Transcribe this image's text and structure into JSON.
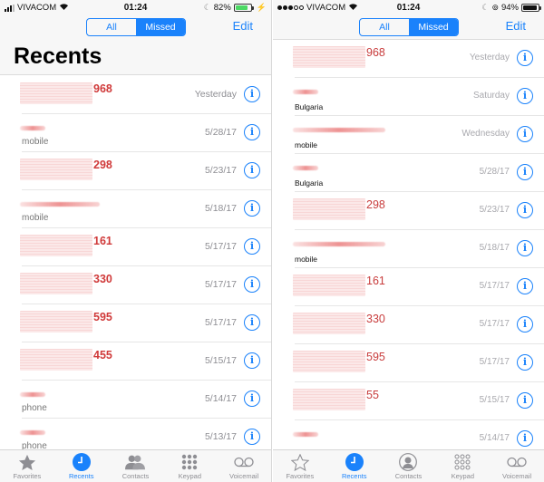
{
  "screens": [
    {
      "status": {
        "carrier": "VIVACOM",
        "time": "01:24",
        "battery": "82%",
        "signal_style": "bars",
        "charging": true
      },
      "nav": {
        "segments": [
          "All",
          "Missed"
        ],
        "active_segment": "Missed",
        "edit": "Edit"
      },
      "title": "Recents",
      "rows": [
        {
          "redacted": "block",
          "suffix": "968",
          "sub": "",
          "date": "Yesterday"
        },
        {
          "redacted": "line-short",
          "suffix": "",
          "sub": "mobile",
          "date": "5/28/17"
        },
        {
          "redacted": "block",
          "suffix": "298",
          "sub": "",
          "date": "5/23/17"
        },
        {
          "redacted": "line-long",
          "suffix": "",
          "sub": "mobile",
          "date": "5/18/17"
        },
        {
          "redacted": "block",
          "suffix": "161",
          "sub": "",
          "date": "5/17/17"
        },
        {
          "redacted": "block",
          "suffix": "330",
          "sub": "",
          "date": "5/17/17"
        },
        {
          "redacted": "block",
          "suffix": "595",
          "sub": "",
          "date": "5/17/17"
        },
        {
          "redacted": "block",
          "suffix": "455",
          "sub": "",
          "date": "5/15/17"
        },
        {
          "redacted": "line-short",
          "suffix": "",
          "sub": "phone",
          "date": "5/14/17"
        },
        {
          "redacted": "line-short",
          "suffix": "",
          "sub": "phone",
          "date": "5/13/17"
        }
      ]
    },
    {
      "status": {
        "carrier": "VIVACOM",
        "time": "01:24",
        "battery": "94%",
        "signal_style": "dots",
        "charging": false
      },
      "nav": {
        "segments": [
          "All",
          "Missed"
        ],
        "active_segment": "Missed",
        "edit": "Edit"
      },
      "title": "",
      "rows": [
        {
          "redacted": "block",
          "suffix": "968",
          "sub": "",
          "date": "Yesterday"
        },
        {
          "redacted": "line-short",
          "suffix": "",
          "sub": "Bulgaria",
          "date": "Saturday"
        },
        {
          "redacted": "line-long",
          "suffix": "",
          "sub": "mobile",
          "date": "Wednesday"
        },
        {
          "redacted": "line-short",
          "suffix": "",
          "sub": "Bulgaria",
          "date": "5/28/17"
        },
        {
          "redacted": "block",
          "suffix": "298",
          "sub": "",
          "date": "5/23/17"
        },
        {
          "redacted": "line-long",
          "suffix": "",
          "sub": "mobile",
          "date": "5/18/17"
        },
        {
          "redacted": "block",
          "suffix": "161",
          "sub": "",
          "date": "5/17/17"
        },
        {
          "redacted": "block",
          "suffix": "330",
          "sub": "",
          "date": "5/17/17"
        },
        {
          "redacted": "block",
          "suffix": "595",
          "sub": "",
          "date": "5/17/17"
        },
        {
          "redacted": "block",
          "suffix": "55",
          "sub": "",
          "date": "5/15/17"
        },
        {
          "redacted": "line-short",
          "suffix": "",
          "sub": "",
          "date": "5/14/17"
        }
      ]
    }
  ],
  "tabbar": {
    "tabs": [
      {
        "label": "Favorites",
        "icon": "star-icon"
      },
      {
        "label": "Recents",
        "icon": "clock-icon",
        "active": true
      },
      {
        "label": "Contacts",
        "icon": "contacts-icon"
      },
      {
        "label": "Keypad",
        "icon": "keypad-icon"
      },
      {
        "label": "Voicemail",
        "icon": "voicemail-icon"
      }
    ]
  },
  "colors": {
    "accent": "#1a82fb",
    "missed": "#d03a3a",
    "secondary": "#8e8e93",
    "battery_green": "#4cd964"
  }
}
